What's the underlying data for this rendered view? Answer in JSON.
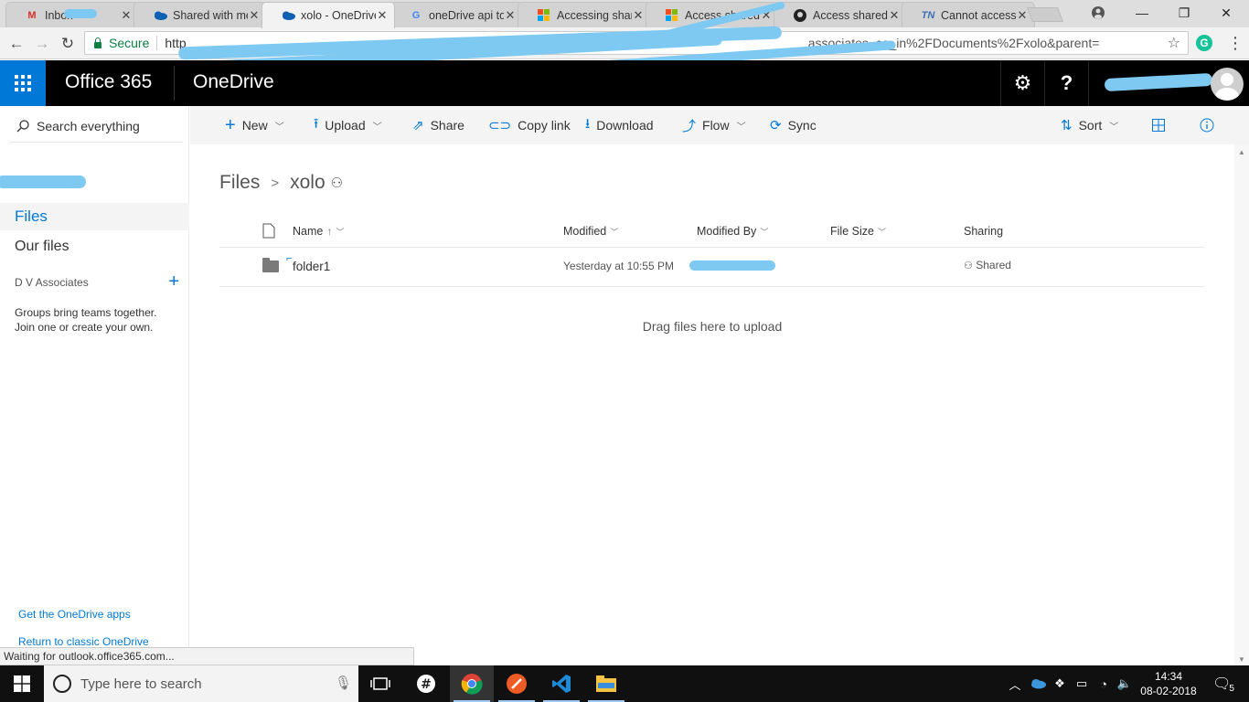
{
  "browser": {
    "tabs": [
      {
        "title": "Inbox",
        "favicon": "gmail-icon"
      },
      {
        "title": "Shared with me",
        "favicon": "onedrive-icon"
      },
      {
        "title": "xolo - OneDrive",
        "favicon": "onedrive-icon",
        "active": true
      },
      {
        "title": "oneDrive api to",
        "favicon": "google-icon"
      },
      {
        "title": "Accessing shar",
        "favicon": "microsoft-icon"
      },
      {
        "title": "Access shared",
        "favicon": "microsoft-icon"
      },
      {
        "title": "Access shared",
        "favicon": "github-icon"
      },
      {
        "title": "Cannot access",
        "favicon": "technet-icon"
      }
    ],
    "secure_label": "Secure",
    "url_start": "http",
    "url_tail": "associates_co_in%2FDocuments%2Fxolo&parent=",
    "status_text": "Waiting for outlook.office365.com..."
  },
  "suite": {
    "brand": "Office 365",
    "app": "OneDrive"
  },
  "leftnav": {
    "search_placeholder": "Search everything",
    "files": "Files",
    "our_files": "Our files",
    "group_name": "D V Associates",
    "group_text": "Groups bring teams together. Join one or create your own.",
    "get_apps": "Get the OneDrive apps",
    "return_classic": "Return to classic OneDrive"
  },
  "commands": {
    "new": "New",
    "upload": "Upload",
    "share": "Share",
    "copy_link": "Copy link",
    "download": "Download",
    "flow": "Flow",
    "sync": "Sync",
    "sort": "Sort"
  },
  "breadcrumb": {
    "root": "Files",
    "current": "xolo"
  },
  "table": {
    "headers": {
      "name": "Name",
      "modified": "Modified",
      "modified_by": "Modified By",
      "file_size": "File Size",
      "sharing": "Sharing"
    },
    "rows": [
      {
        "name": "folder1",
        "modified": "Yesterday at 10:55 PM",
        "modified_by": "",
        "file_size": "",
        "sharing": "Shared"
      }
    ]
  },
  "dropzone": "Drag files here to upload",
  "taskbar": {
    "search_placeholder": "Type here to search",
    "time": "14:34",
    "date": "08-02-2018",
    "notifications": "5"
  },
  "colors": {
    "accent": "#0078d7",
    "suite_bar": "#000000",
    "scribble": "#7ec9f2"
  }
}
